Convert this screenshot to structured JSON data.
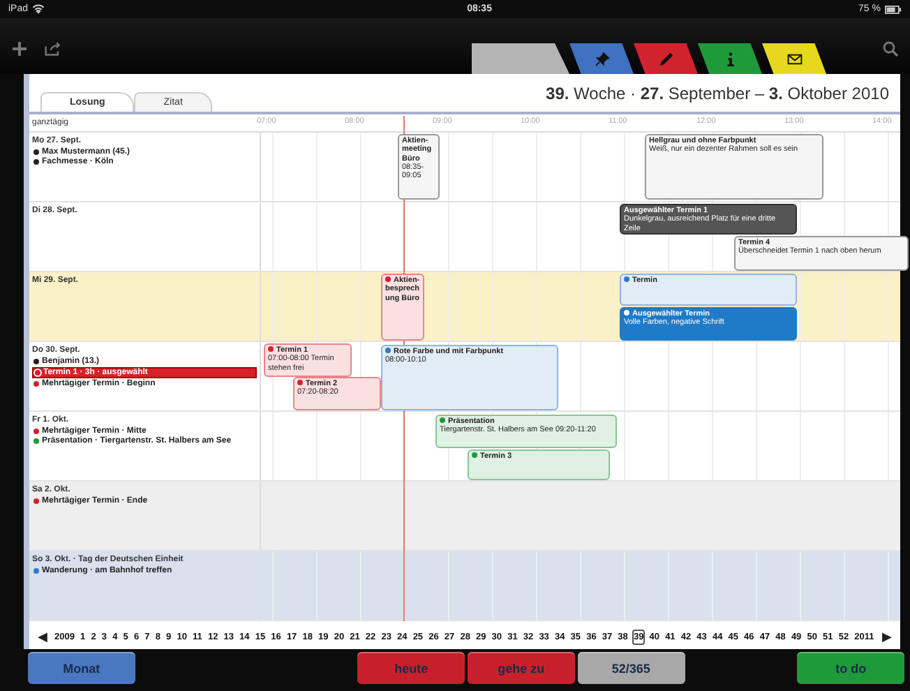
{
  "status_bar": {
    "device": "iPad",
    "time": "08:35",
    "battery": "75 %"
  },
  "toolbar_tabs": [
    {
      "kind": "blank",
      "color": "#b4b4b4"
    },
    {
      "kind": "pin",
      "color": "#3f72c0"
    },
    {
      "kind": "pencil",
      "color": "#d0232e"
    },
    {
      "kind": "info",
      "color": "#1f9a3a"
    },
    {
      "kind": "mail",
      "color": "#e6d81e"
    }
  ],
  "text_tabs": [
    {
      "label": "Losung",
      "selected": true
    },
    {
      "label": "Zitat",
      "selected": false
    }
  ],
  "week_title": "**39.** Woche · **27.** September – **3.** Oktober 2010",
  "allday_label": "ganztägig",
  "hours": [
    "07:00",
    "08:00",
    "09:00",
    "10:00",
    "11:00",
    "12:00",
    "13:00",
    "14:00"
  ],
  "days": [
    {
      "label": "Mo 27. Sept.",
      "kind": "weekday",
      "items": [
        {
          "text": "Max Mustermann (45.)",
          "color": "#222222",
          "selected": false
        },
        {
          "text": "Fachmesse · Köln",
          "color": "#222222",
          "selected": false
        }
      ],
      "events": [
        {
          "kind": "outline",
          "title": "Aktien-meeting Büro",
          "detail": "08:35-09:05"
        },
        {
          "kind": "outline",
          "title": "Hellgrau und ohne Farbpunkt",
          "detail": "Weiß, nur ein dezenter Rahmen soll es sein"
        }
      ]
    },
    {
      "label": "Di 28. Sept.",
      "kind": "weekday",
      "events": [
        {
          "kind": "dark",
          "title": "Ausgewählter Termin 1",
          "detail": "Dunkelgrau, ausreichend Platz für eine dritte Zeile"
        },
        {
          "kind": "outline",
          "title": "Termin 4",
          "detail": "Überschneidet Termin 1 nach oben herum"
        }
      ]
    },
    {
      "label": "Mi 29. Sept.",
      "kind": "today",
      "events": [
        {
          "kind": "tinted",
          "color": "#d8202a",
          "title": "Aktien-besprechung Büro"
        },
        {
          "kind": "tinted",
          "color": "#2f78c8",
          "title": "Termin"
        },
        {
          "kind": "selected",
          "color": "#1f7ac8",
          "title": "Ausgewählter Termin",
          "detail": "Volle Farben, negative Schrift"
        }
      ]
    },
    {
      "label": "Do 30. Sept.",
      "kind": "weekday",
      "items": [
        {
          "text": "Benjamin (13.)",
          "color": "#222222",
          "selected": false
        },
        {
          "text": "Termin 1 · 3h · ausgewählt",
          "color": "#d8202a",
          "selected": true
        },
        {
          "text": "Mehrtägiger Termin · Beginn",
          "color": "#d8202a",
          "selected": false
        }
      ],
      "events": [
        {
          "kind": "tinted",
          "color": "#d8202a",
          "title": "Termin 1",
          "detail": "07:00-08:00 Termin stehen frei"
        },
        {
          "kind": "tinted",
          "color": "#d8202a",
          "title": "Termin 2",
          "detail": "07:20-08:20"
        },
        {
          "kind": "tinted",
          "color": "#2f78c8",
          "title": "Rote Farbe und mit Farbpunkt",
          "detail": "08:00-10:10"
        }
      ]
    },
    {
      "label": "Fr 1. Okt.",
      "kind": "weekday",
      "items": [
        {
          "text": "Mehrtägiger Termin · Mitte",
          "color": "#d8202a",
          "selected": false
        },
        {
          "text": "Präsentation · Tiergartenstr. St. Halbers am See",
          "color": "#1f9a3a",
          "selected": false
        }
      ],
      "events": [
        {
          "kind": "tinted",
          "color": "#1f9a3a",
          "title": "Präsentation",
          "detail": "Tiergartenstr. St. Halbers am See 09:20-11:20"
        },
        {
          "kind": "tinted",
          "color": "#1f9a3a",
          "title": "Termin 3"
        }
      ]
    },
    {
      "label": "Sa 2. Okt.",
      "kind": "saturday",
      "items": [
        {
          "text": "Mehrtägiger Termin · Ende",
          "color": "#d8202a",
          "selected": false
        }
      ]
    },
    {
      "label": "So 3. Okt. · Tag der Deutschen Einheit",
      "kind": "holiday",
      "items": [
        {
          "text": "Wanderung · am Bahnhof treffen",
          "color": "#2f78c8",
          "selected": false
        }
      ]
    }
  ],
  "week_nav": {
    "prev": "◀",
    "next": "▶",
    "weeks": [
      {
        "label": "2009",
        "selected": false
      },
      {
        "label": "1",
        "selected": false
      },
      {
        "label": "2",
        "selected": false
      },
      {
        "label": "3",
        "selected": false
      },
      {
        "label": "4",
        "selected": false
      },
      {
        "label": "5",
        "selected": false
      },
      {
        "label": "6",
        "selected": false
      },
      {
        "label": "7",
        "selected": false
      },
      {
        "label": "8",
        "selected": false
      },
      {
        "label": "9",
        "selected": false
      },
      {
        "label": "10",
        "selected": false
      },
      {
        "label": "11",
        "selected": false
      },
      {
        "label": "12",
        "selected": false
      },
      {
        "label": "13",
        "selected": false
      },
      {
        "label": "14",
        "selected": false
      },
      {
        "label": "15",
        "selected": false
      },
      {
        "label": "16",
        "selected": false
      },
      {
        "label": "17",
        "selected": false
      },
      {
        "label": "18",
        "selected": false
      },
      {
        "label": "19",
        "selected": false
      },
      {
        "label": "20",
        "selected": false
      },
      {
        "label": "21",
        "selected": false
      },
      {
        "label": "22",
        "selected": false
      },
      {
        "label": "23",
        "selected": false
      },
      {
        "label": "24",
        "selected": false
      },
      {
        "label": "25",
        "selected": false
      },
      {
        "label": "26",
        "selected": false
      },
      {
        "label": "27",
        "selected": false
      },
      {
        "label": "28",
        "selected": false
      },
      {
        "label": "29",
        "selected": false
      },
      {
        "label": "30",
        "selected": false
      },
      {
        "label": "31",
        "selected": false
      },
      {
        "label": "32",
        "selected": false
      },
      {
        "label": "33",
        "selected": false
      },
      {
        "label": "34",
        "selected": false
      },
      {
        "label": "35",
        "selected": false
      },
      {
        "label": "36",
        "selected": false
      },
      {
        "label": "37",
        "selected": false
      },
      {
        "label": "38",
        "selected": false
      },
      {
        "label": "39",
        "selected": true
      },
      {
        "label": "40",
        "selected": false
      },
      {
        "label": "41",
        "selected": false
      },
      {
        "label": "42",
        "selected": false
      },
      {
        "label": "43",
        "selected": false
      },
      {
        "label": "44",
        "selected": false
      },
      {
        "label": "45",
        "selected": false
      },
      {
        "label": "46",
        "selected": false
      },
      {
        "label": "47",
        "selected": false
      },
      {
        "label": "48",
        "selected": false
      },
      {
        "label": "49",
        "selected": false
      },
      {
        "label": "50",
        "selected": false
      },
      {
        "label": "51",
        "selected": false
      },
      {
        "label": "52",
        "selected": false
      },
      {
        "label": "2011",
        "selected": false
      }
    ]
  },
  "bottom_buttons": [
    {
      "label": "Monat",
      "color": "#4a78c0"
    },
    {
      "label": "heute",
      "color": "#c8202a"
    },
    {
      "label": "gehe zu",
      "color": "#c8202a"
    },
    {
      "label": "52/365",
      "color": "#a8a8a8"
    },
    {
      "label": "to do",
      "color": "#1f9a3a"
    }
  ]
}
